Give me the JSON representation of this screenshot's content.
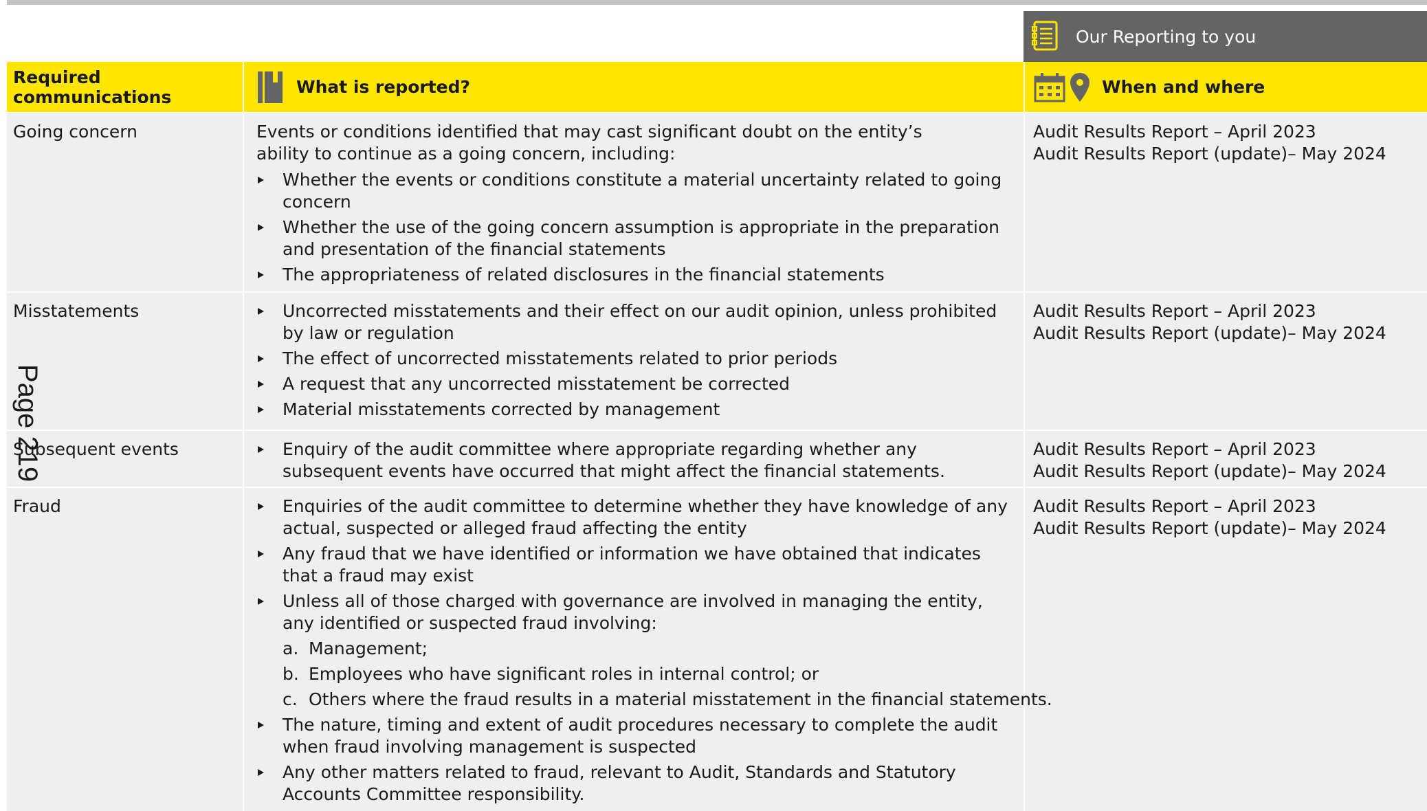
{
  "banner": {
    "label": "Our Reporting to you",
    "icon": "checklist-document-icon"
  },
  "header": {
    "col1": "Required communications",
    "col2": "What is reported?",
    "col3": "When and where",
    "col2_icon": "notebook-icon",
    "col3_icons": [
      "calendar-icon",
      "location-pin-icon"
    ]
  },
  "rows": [
    {
      "topic": "Going concern",
      "intro": "Events or conditions identified that may cast significant doubt on the entity’s ability to continue as a going concern, including:",
      "bullets": [
        "Whether the events or conditions constitute a material uncertainty related to going concern",
        "Whether the use of the going concern assumption is appropriate in the preparation and presentation of the financial statements",
        "The appropriateness of related disclosures in the financial statements"
      ],
      "when": [
        "Audit Results Report – April 2023",
        "Audit Results Report (update)– May 2024"
      ]
    },
    {
      "topic": "Misstatements",
      "bullets": [
        "Uncorrected misstatements and their effect on our audit opinion, unless prohibited by law or regulation",
        "The effect of uncorrected misstatements related to prior periods",
        "A request that any uncorrected misstatement be corrected",
        "Material misstatements corrected by management"
      ],
      "when": [
        "Audit Results Report – April 2023",
        "Audit Results Report (update)– May 2024"
      ]
    },
    {
      "topic": "Subsequent events",
      "bullets": [
        "Enquiry of the audit committee where appropriate regarding whether any subsequent events have occurred that might affect the financial statements."
      ],
      "when": [
        "Audit Results Report – April 2023",
        "Audit Results Report (update)– May 2024"
      ]
    },
    {
      "topic": "Fraud",
      "bullets_before": [
        "Enquiries of the audit committee to determine whether they have knowledge of any actual, suspected or alleged fraud affecting the entity",
        "Any fraud that we have identified or information we have obtained that indicates that a fraud may exist",
        "Unless all of those charged with governance are involved in managing the entity, any identified or suspected fraud involving:"
      ],
      "sub_items": [
        {
          "marker": "a.",
          "text": "Management;"
        },
        {
          "marker": "b.",
          "text": "Employees who have significant roles in internal control; or"
        },
        {
          "marker": "c.",
          "text": "Others where the fraud results in a material misstatement in the financial statements."
        }
      ],
      "bullets_after": [
        "The nature, timing and extent of audit procedures necessary to complete the audit when fraud involving management is suspected",
        "Any other matters related to fraud, relevant to Audit, Standards and Statutory Accounts Committee responsibility."
      ],
      "when": [
        "Audit Results Report – April 2023",
        "Audit Results Report (update)– May 2024"
      ]
    }
  ],
  "page_marker": "Page 219"
}
